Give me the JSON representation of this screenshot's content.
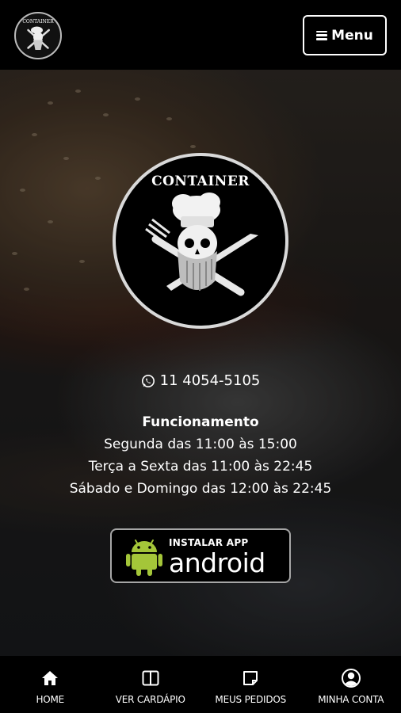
{
  "header": {
    "logo_text": "CONTAINER",
    "menu_label": "Menu"
  },
  "hero": {
    "logo_text": "CONTAINER",
    "phone": "11 4054-5105",
    "hours": {
      "title": "Funcionamento",
      "lines": [
        "Segunda das 11:00 às 15:00",
        "Terça a Sexta das 11:00 às 22:45",
        "Sábado e Domingo das 12:00 às 22:45"
      ]
    },
    "app_button": {
      "small_label": "INSTALAR APP",
      "big_label": "android",
      "accent": "#a4c639"
    }
  },
  "bottom_nav": {
    "items": [
      {
        "label": "HOME",
        "icon": "home-icon"
      },
      {
        "label": "VER CARDÁPIO",
        "icon": "menu-book-icon"
      },
      {
        "label": "MEUS PEDIDOS",
        "icon": "orders-icon"
      },
      {
        "label": "MINHA CONTA",
        "icon": "user-icon"
      }
    ]
  }
}
